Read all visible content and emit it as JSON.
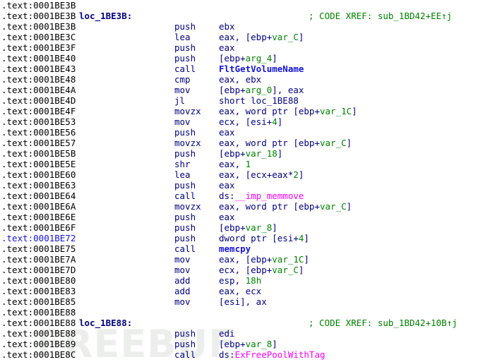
{
  "app": {
    "view": "IDA Pro disassembly listing",
    "segment": ".text",
    "watermark": "FREEBUF"
  },
  "colors": {
    "background": "#ffffff",
    "address": "#000000",
    "address_highlight": "#1414d2",
    "code": "#00007b",
    "label": "#00007b",
    "variable": "#008000",
    "comment": "#008000",
    "api_call": "#1414d2",
    "import": "#ff00ff",
    "watermark": "#eceeec"
  },
  "listing": {
    "cursor_address": ".text:0001BE72",
    "rows": [
      {
        "addr": ".text:0001BE3B",
        "label": "",
        "mnem": "",
        "ops": [],
        "comment": ""
      },
      {
        "addr": ".text:0001BE3B",
        "label": "loc_1BE3B:",
        "mnem": "",
        "ops": [],
        "comment": "; CODE XREF: sub_1BD42+EE↑j"
      },
      {
        "addr": ".text:0001BE3B",
        "label": "",
        "mnem": "push",
        "ops": [
          {
            "t": "ebx",
            "c": "n"
          }
        ],
        "comment": ""
      },
      {
        "addr": ".text:0001BE3C",
        "label": "",
        "mnem": "lea",
        "ops": [
          {
            "t": "eax, [ebp+",
            "c": "n"
          },
          {
            "t": "var_C",
            "c": "v"
          },
          {
            "t": "]",
            "c": "n"
          }
        ],
        "comment": ""
      },
      {
        "addr": ".text:0001BE3F",
        "label": "",
        "mnem": "push",
        "ops": [
          {
            "t": "eax",
            "c": "n"
          }
        ],
        "comment": ""
      },
      {
        "addr": ".text:0001BE40",
        "label": "",
        "mnem": "push",
        "ops": [
          {
            "t": "[ebp+",
            "c": "n"
          },
          {
            "t": "arg_4",
            "c": "v"
          },
          {
            "t": "]",
            "c": "n"
          }
        ],
        "comment": ""
      },
      {
        "addr": ".text:0001BE43",
        "label": "",
        "mnem": "call",
        "ops": [
          {
            "t": "FltGetVolumeName",
            "c": "api"
          }
        ],
        "comment": ""
      },
      {
        "addr": ".text:0001BE48",
        "label": "",
        "mnem": "cmp",
        "ops": [
          {
            "t": "eax, ebx",
            "c": "n"
          }
        ],
        "comment": ""
      },
      {
        "addr": ".text:0001BE4A",
        "label": "",
        "mnem": "mov",
        "ops": [
          {
            "t": "[ebp+",
            "c": "n"
          },
          {
            "t": "arg_0",
            "c": "v"
          },
          {
            "t": "], eax",
            "c": "n"
          }
        ],
        "comment": ""
      },
      {
        "addr": ".text:0001BE4D",
        "label": "",
        "mnem": "jl",
        "ops": [
          {
            "t": "short loc_1BE88",
            "c": "n"
          }
        ],
        "comment": ""
      },
      {
        "addr": ".text:0001BE4F",
        "label": "",
        "mnem": "movzx",
        "ops": [
          {
            "t": "eax, word ptr [ebp+",
            "c": "n"
          },
          {
            "t": "var_1C",
            "c": "v"
          },
          {
            "t": "]",
            "c": "n"
          }
        ],
        "comment": ""
      },
      {
        "addr": ".text:0001BE53",
        "label": "",
        "mnem": "mov",
        "ops": [
          {
            "t": "ecx, [esi+",
            "c": "n"
          },
          {
            "t": "4",
            "c": "v"
          },
          {
            "t": "]",
            "c": "n"
          }
        ],
        "comment": ""
      },
      {
        "addr": ".text:0001BE56",
        "label": "",
        "mnem": "push",
        "ops": [
          {
            "t": "eax",
            "c": "n"
          }
        ],
        "comment": ""
      },
      {
        "addr": ".text:0001BE57",
        "label": "",
        "mnem": "movzx",
        "ops": [
          {
            "t": "eax, word ptr [ebp+",
            "c": "n"
          },
          {
            "t": "var_C",
            "c": "v"
          },
          {
            "t": "]",
            "c": "n"
          }
        ],
        "comment": ""
      },
      {
        "addr": ".text:0001BE5B",
        "label": "",
        "mnem": "push",
        "ops": [
          {
            "t": "[ebp+",
            "c": "n"
          },
          {
            "t": "var_18",
            "c": "v"
          },
          {
            "t": "]",
            "c": "n"
          }
        ],
        "comment": ""
      },
      {
        "addr": ".text:0001BE5E",
        "label": "",
        "mnem": "shr",
        "ops": [
          {
            "t": "eax, ",
            "c": "n"
          },
          {
            "t": "1",
            "c": "v"
          }
        ],
        "comment": ""
      },
      {
        "addr": ".text:0001BE60",
        "label": "",
        "mnem": "lea",
        "ops": [
          {
            "t": "eax, [ecx+eax*",
            "c": "n"
          },
          {
            "t": "2",
            "c": "v"
          },
          {
            "t": "]",
            "c": "n"
          }
        ],
        "comment": ""
      },
      {
        "addr": ".text:0001BE63",
        "label": "",
        "mnem": "push",
        "ops": [
          {
            "t": "eax",
            "c": "n"
          }
        ],
        "comment": ""
      },
      {
        "addr": ".text:0001BE64",
        "label": "",
        "mnem": "call",
        "ops": [
          {
            "t": "ds:",
            "c": "n"
          },
          {
            "t": "__imp_memmove",
            "c": "imp"
          }
        ],
        "comment": ""
      },
      {
        "addr": ".text:0001BE6A",
        "label": "",
        "mnem": "movzx",
        "ops": [
          {
            "t": "eax, word ptr [ebp+",
            "c": "n"
          },
          {
            "t": "var_C",
            "c": "v"
          },
          {
            "t": "]",
            "c": "n"
          }
        ],
        "comment": ""
      },
      {
        "addr": ".text:0001BE6E",
        "label": "",
        "mnem": "push",
        "ops": [
          {
            "t": "eax",
            "c": "n"
          }
        ],
        "comment": ""
      },
      {
        "addr": ".text:0001BE6F",
        "label": "",
        "mnem": "push",
        "ops": [
          {
            "t": "[ebp+",
            "c": "n"
          },
          {
            "t": "var_8",
            "c": "v"
          },
          {
            "t": "]",
            "c": "n"
          }
        ],
        "comment": ""
      },
      {
        "addr": ".text:0001BE72",
        "label": "",
        "mnem": "push",
        "ops": [
          {
            "t": "dword ptr [esi+",
            "c": "n"
          },
          {
            "t": "4",
            "c": "v"
          },
          {
            "t": "]",
            "c": "n"
          }
        ],
        "comment": ""
      },
      {
        "addr": ".text:0001BE75",
        "label": "",
        "mnem": "call",
        "ops": [
          {
            "t": "memcpy",
            "c": "api"
          }
        ],
        "comment": ""
      },
      {
        "addr": ".text:0001BE7A",
        "label": "",
        "mnem": "mov",
        "ops": [
          {
            "t": "eax, [ebp+",
            "c": "n"
          },
          {
            "t": "var_1C",
            "c": "v"
          },
          {
            "t": "]",
            "c": "n"
          }
        ],
        "comment": ""
      },
      {
        "addr": ".text:0001BE7D",
        "label": "",
        "mnem": "mov",
        "ops": [
          {
            "t": "ecx, [ebp+",
            "c": "n"
          },
          {
            "t": "var_C",
            "c": "v"
          },
          {
            "t": "]",
            "c": "n"
          }
        ],
        "comment": ""
      },
      {
        "addr": ".text:0001BE80",
        "label": "",
        "mnem": "add",
        "ops": [
          {
            "t": "esp, ",
            "c": "n"
          },
          {
            "t": "18h",
            "c": "v"
          }
        ],
        "comment": ""
      },
      {
        "addr": ".text:0001BE83",
        "label": "",
        "mnem": "add",
        "ops": [
          {
            "t": "eax, ecx",
            "c": "n"
          }
        ],
        "comment": ""
      },
      {
        "addr": ".text:0001BE85",
        "label": "",
        "mnem": "mov",
        "ops": [
          {
            "t": "[esi], ax",
            "c": "n"
          }
        ],
        "comment": ""
      },
      {
        "addr": ".text:0001BE88",
        "label": "",
        "mnem": "",
        "ops": [],
        "comment": ""
      },
      {
        "addr": ".text:0001BE88",
        "label": "loc_1BE88:",
        "mnem": "",
        "ops": [],
        "comment": "; CODE XREF: sub_1BD42+10B↑j"
      },
      {
        "addr": ".text:0001BE88",
        "label": "",
        "mnem": "push",
        "ops": [
          {
            "t": "edi",
            "c": "n"
          }
        ],
        "comment": ""
      },
      {
        "addr": ".text:0001BE89",
        "label": "",
        "mnem": "push",
        "ops": [
          {
            "t": "[ebp+",
            "c": "n"
          },
          {
            "t": "var_8",
            "c": "v"
          },
          {
            "t": "]",
            "c": "n"
          }
        ],
        "comment": ""
      },
      {
        "addr": ".text:0001BE8C",
        "label": "",
        "mnem": "call",
        "ops": [
          {
            "t": "ds:",
            "c": "n"
          },
          {
            "t": "ExFreePoolWithTag",
            "c": "imp"
          }
        ],
        "comment": ""
      }
    ]
  }
}
